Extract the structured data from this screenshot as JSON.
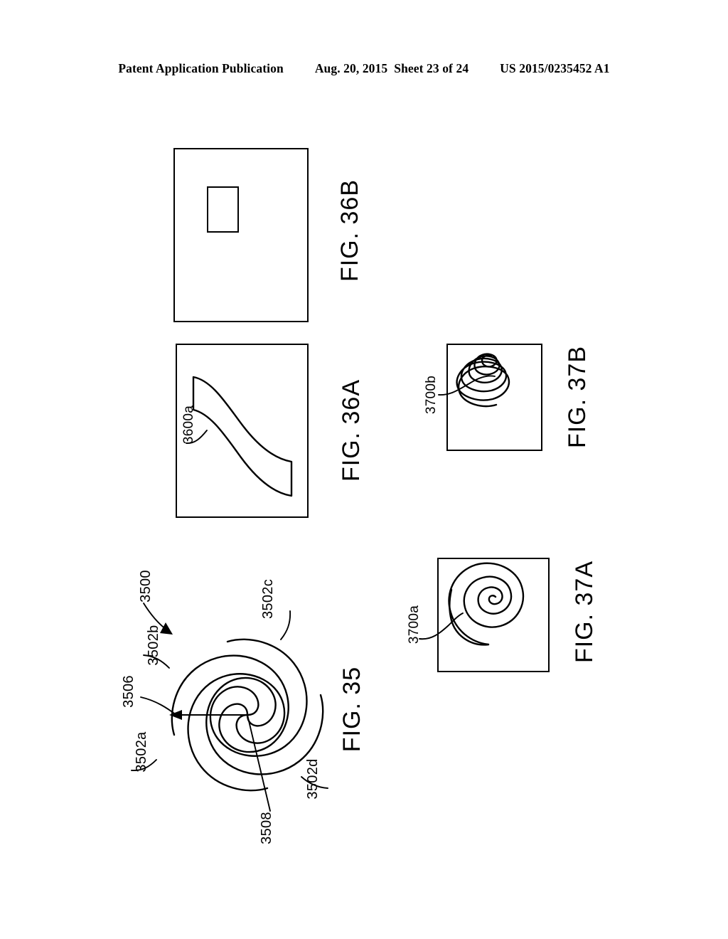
{
  "header": {
    "publication": "Patent Application Publication",
    "date": "Aug. 20, 2015",
    "sheet": "Sheet 23 of 24",
    "serial": "US 2015/0235452 A1"
  },
  "figures": [
    {
      "id": "fig-36b",
      "caption": "FIG. 36B",
      "description": "Empty rectangular plate containing a small upright inner rectangle near the upper left",
      "refs": []
    },
    {
      "id": "fig-36a",
      "caption": "FIG. 36A",
      "description": "Rectangular plate containing an S-curved ribbon band running from upper left to lower right",
      "refs": [
        {
          "name": "3600a",
          "target": "curved ribbon band"
        }
      ]
    },
    {
      "id": "fig-37b",
      "caption": "FIG. 37B",
      "description": "Rectangular plate containing a conical helix coil of decreasing loop size",
      "refs": [
        {
          "name": "3700b",
          "target": "conical helix coil"
        }
      ]
    },
    {
      "id": "fig-37a",
      "caption": "FIG. 37A",
      "description": "Rectangular plate containing a flat planar Archimedean spiral",
      "refs": [
        {
          "name": "3700a",
          "target": "planar spiral"
        }
      ]
    },
    {
      "id": "fig-35",
      "caption": "FIG. 35",
      "description": "Four-arm spiral assembly with a central hub and a radius dimension arrow",
      "refs": [
        {
          "name": "3500",
          "target": "overall spiral assembly"
        },
        {
          "name": "3502a",
          "target": "spiral arm a"
        },
        {
          "name": "3502b",
          "target": "spiral arm b"
        },
        {
          "name": "3502c",
          "target": "spiral arm c"
        },
        {
          "name": "3502d",
          "target": "spiral arm d"
        },
        {
          "name": "3506",
          "target": "central hub"
        },
        {
          "name": "3508",
          "target": "radial reference line"
        }
      ]
    }
  ],
  "colors": {
    "ink": "#000000",
    "page": "#ffffff"
  }
}
